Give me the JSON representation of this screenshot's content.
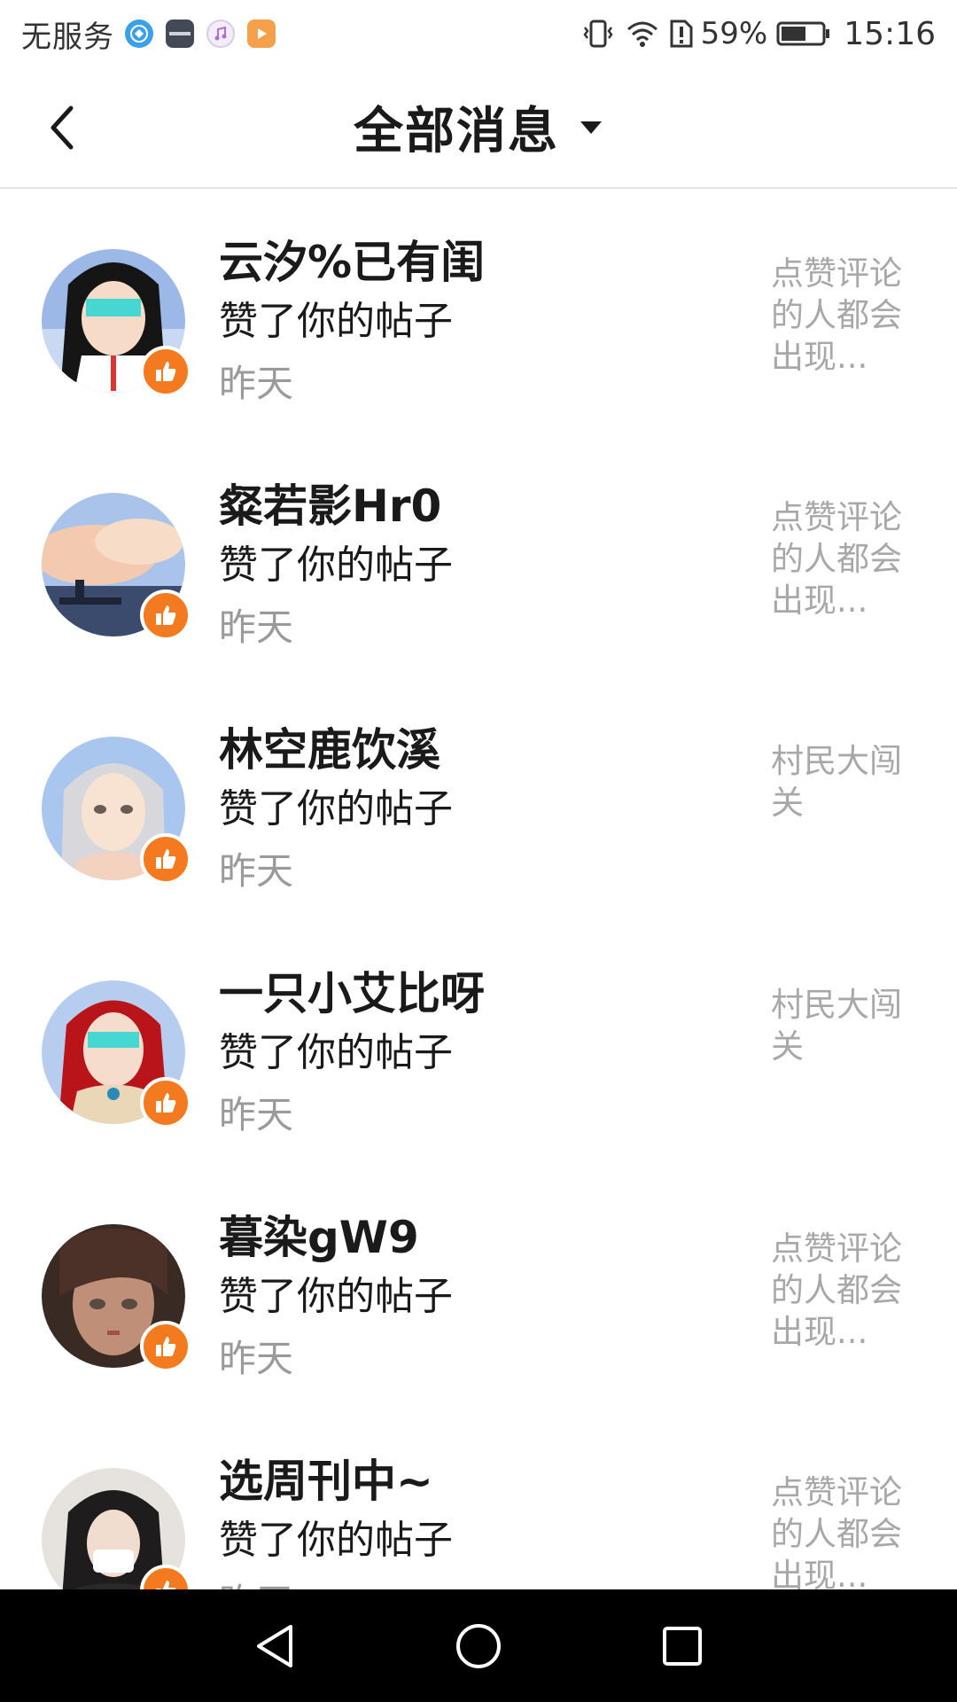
{
  "status_bar": {
    "carrier": "无服务",
    "battery_percent": "59%",
    "time": "15:16",
    "icons": [
      "browser-icon",
      "huawei-icon",
      "music-icon",
      "video-icon",
      "vibrate-icon",
      "wifi-icon",
      "sim-alert-icon",
      "battery-icon"
    ]
  },
  "header": {
    "title": "全部消息",
    "back_icon": "chevron-left-icon",
    "filter_icon": "caret-down-icon"
  },
  "messages": [
    {
      "user": "云汐%已有闺",
      "action": "赞了你的帖子",
      "time": "昨天",
      "preview": "点赞评论的人都会出现..."
    },
    {
      "user": "粲若影Hr0",
      "action": "赞了你的帖子",
      "time": "昨天",
      "preview": "点赞评论的人都会出现..."
    },
    {
      "user": "林空鹿饮溪",
      "action": "赞了你的帖子",
      "time": "昨天",
      "preview": "村民大闯关"
    },
    {
      "user": "一只小艾比呀",
      "action": "赞了你的帖子",
      "time": "昨天",
      "preview": "村民大闯关"
    },
    {
      "user": "暮染gW9",
      "action": "赞了你的帖子",
      "time": "昨天",
      "preview": "点赞评论的人都会出现..."
    },
    {
      "user": "选周刊中~",
      "action": "赞了你的帖子",
      "time": "昨天",
      "preview": "点赞评论的人都会出现..."
    }
  ],
  "colors": {
    "accent_like": "#f47a1f",
    "text_primary": "#1a1a1a",
    "text_secondary": "#9a9a9a",
    "nav_bar": "#000000"
  },
  "nav_bar": {
    "icons": [
      "back-triangle-icon",
      "home-circle-icon",
      "recents-square-icon"
    ]
  }
}
